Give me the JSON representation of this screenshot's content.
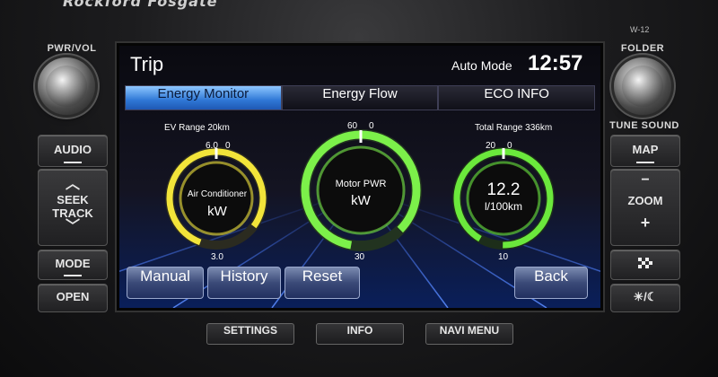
{
  "device": {
    "brand": "Rockford Fosgate",
    "model": "W-12"
  },
  "left_panel": {
    "pwr_label": "PWR/VOL",
    "buttons": {
      "audio": "AUDIO",
      "seek_track": "SEEK\nTRACK",
      "mode": "MODE",
      "open": "OPEN"
    },
    "seek_line1": "SEEK",
    "seek_line2": "TRACK"
  },
  "right_panel": {
    "folder_label": "FOLDER",
    "tune_label": "TUNE SOUND",
    "map": "MAP",
    "zoom": "ZOOM",
    "zoom_minus": "−",
    "zoom_plus": "+",
    "flag_icon": "checkered-flag",
    "daynight": "☀/☾"
  },
  "screen": {
    "title": "Trip",
    "mode": "Auto Mode",
    "time": "12:57",
    "tabs": [
      {
        "label": "Energy Monitor",
        "active": true
      },
      {
        "label": "Energy Flow",
        "active": false
      },
      {
        "label": "ECO INFO",
        "active": false
      }
    ],
    "gauges": {
      "left": {
        "heading": "EV Range 20km",
        "max": "6.0",
        "zero": "0",
        "min": "3.0",
        "name": "Air Conditioner",
        "unit": "kW",
        "color": "#f2e43a"
      },
      "center": {
        "max": "60",
        "zero": "0",
        "min": "30",
        "name": "Motor PWR",
        "unit": "kW",
        "color": "#7cf04a"
      },
      "right": {
        "heading": "Total Range 336km",
        "max": "20",
        "zero": "0",
        "min": "10",
        "value": "12.2",
        "unit": "l/100km",
        "color": "#6be83c"
      }
    },
    "buttons": {
      "manual": "Manual",
      "history": "History",
      "reset": "Reset",
      "back": "Back"
    }
  },
  "bottom_buttons": {
    "settings": "SETTINGS",
    "info": "INFO",
    "navi_menu": "NAVI MENU"
  }
}
